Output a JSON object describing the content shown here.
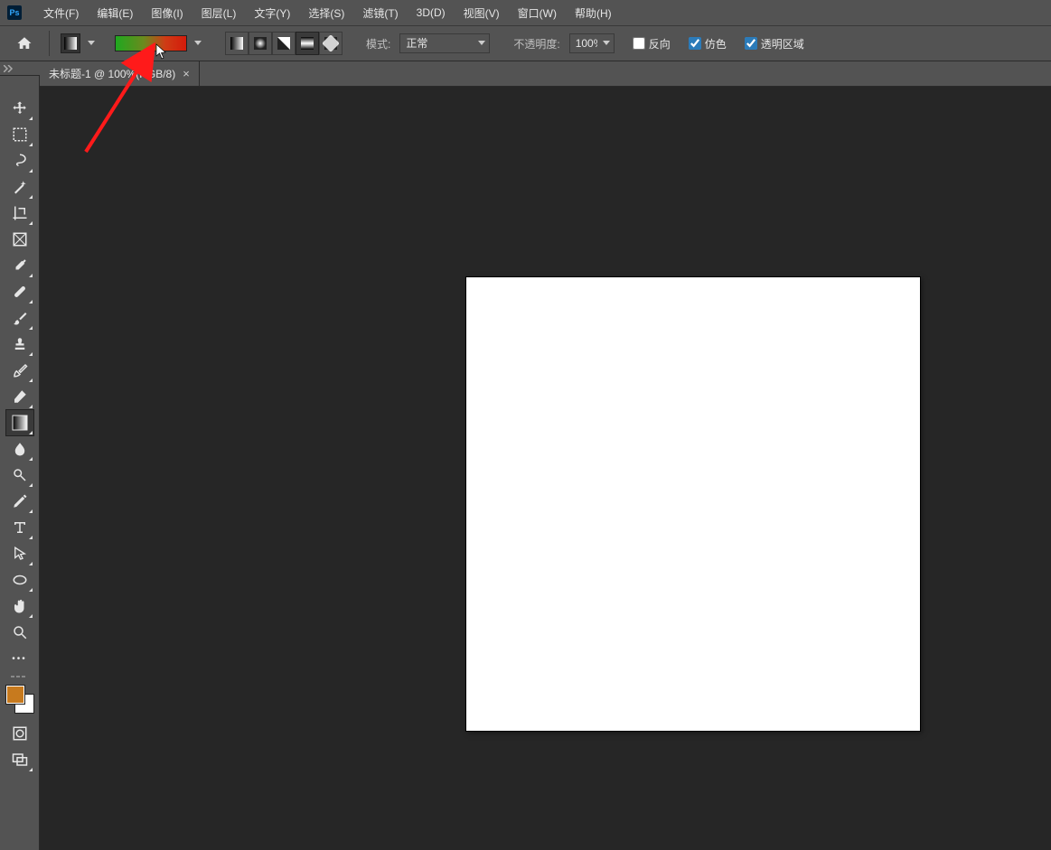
{
  "menu": {
    "items": [
      "文件(F)",
      "编辑(E)",
      "图像(I)",
      "图层(L)",
      "文字(Y)",
      "选择(S)",
      "滤镜(T)",
      "3D(D)",
      "视图(V)",
      "窗口(W)",
      "帮助(H)"
    ]
  },
  "options": {
    "mode_label": "模式:",
    "mode_value": "正常",
    "opacity_label": "不透明度:",
    "opacity_value": "100%",
    "reverse_label": "反向",
    "dither_label": "仿色",
    "transparency_label": "透明区域",
    "reverse_checked": false,
    "dither_checked": true,
    "transparency_checked": true,
    "gradient_types": [
      "linear",
      "radial",
      "angle",
      "reflected",
      "diamond"
    ],
    "gradient_type_active": 3,
    "gradient_preview_colors": {
      "from": "#1fa81f",
      "to": "#d41b0b"
    }
  },
  "document": {
    "tab_title": "未标题-1 @ 100%(RGB/8)"
  },
  "tools": {
    "active_index": 12,
    "foreground_color": "#c77a1e",
    "background_color": "#ffffff",
    "items": [
      "move-tool",
      "marquee-tool",
      "lasso-tool",
      "quick-select-tool",
      "crop-tool",
      "frame-tool",
      "eyedropper-tool",
      "healing-brush-tool",
      "brush-tool",
      "clone-stamp-tool",
      "history-brush-tool",
      "eraser-tool",
      "gradient-tool",
      "blur-tool",
      "dodge-tool",
      "pen-tool",
      "type-tool",
      "path-select-tool",
      "shape-tool",
      "hand-tool",
      "zoom-tool"
    ]
  }
}
